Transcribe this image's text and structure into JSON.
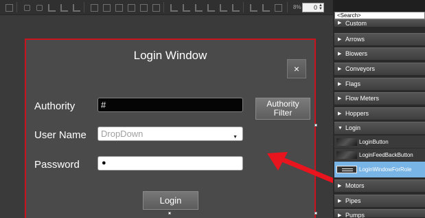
{
  "toolbar": {
    "zoom_label": "8%",
    "zoom_value": "0"
  },
  "dialog": {
    "title": "Login Window",
    "close_label": "×",
    "authority_label": "Authority",
    "authority_value": "#",
    "authority_filter_label": "Authority\nFilter",
    "username_label": "User Name",
    "username_placeholder": "DropDown",
    "password_label": "Password",
    "password_value": "●",
    "login_label": "Login"
  },
  "toolbox": {
    "search_placeholder": "<Search>",
    "categories": [
      {
        "label": "Custom"
      },
      {
        "label": "Arrows"
      },
      {
        "label": "Blowers"
      },
      {
        "label": "Conveyors"
      },
      {
        "label": "Flags"
      },
      {
        "label": "Flow Meters"
      },
      {
        "label": "Hoppers"
      },
      {
        "label": "Login"
      },
      {
        "label": "Motors"
      },
      {
        "label": "Pipes"
      },
      {
        "label": "Pumps"
      }
    ],
    "login_items": [
      {
        "label": "LoginButton"
      },
      {
        "label": "LoginFeedBackButton"
      },
      {
        "label": "LoginWindowForRole"
      }
    ]
  },
  "colors": {
    "selection_border": "#c8141e",
    "annotation_arrow": "#e8141e",
    "selected_item": "#78b4e6"
  }
}
